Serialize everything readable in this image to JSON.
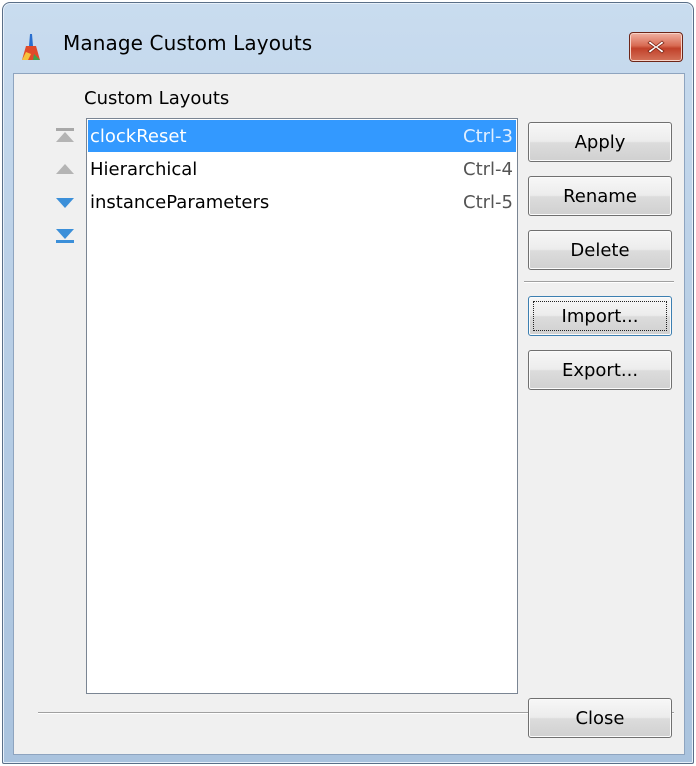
{
  "window": {
    "title": "Manage Custom Layouts",
    "title_icon": "app-icon",
    "close_icon": "close-icon"
  },
  "section_label": "Custom Layouts",
  "reorder_controls": [
    {
      "icon": "move-to-top-icon"
    },
    {
      "icon": "move-up-icon"
    },
    {
      "icon": "move-down-icon"
    },
    {
      "icon": "move-to-bottom-icon"
    }
  ],
  "layouts": [
    {
      "name": "clockReset",
      "shortcut": "Ctrl-3",
      "selected": true
    },
    {
      "name": "Hierarchical",
      "shortcut": "Ctrl-4",
      "selected": false
    },
    {
      "name": "instanceParameters",
      "shortcut": "Ctrl-5",
      "selected": false
    }
  ],
  "buttons": {
    "apply": "Apply",
    "rename": "Rename",
    "delete": "Delete",
    "import": "Import...",
    "export": "Export...",
    "close": "Close"
  },
  "colors": {
    "selection": "#3399ff",
    "close_button": "#c1412a",
    "arrow_blue": "#3b8fd9",
    "arrow_gray": "#a8a8a8"
  }
}
